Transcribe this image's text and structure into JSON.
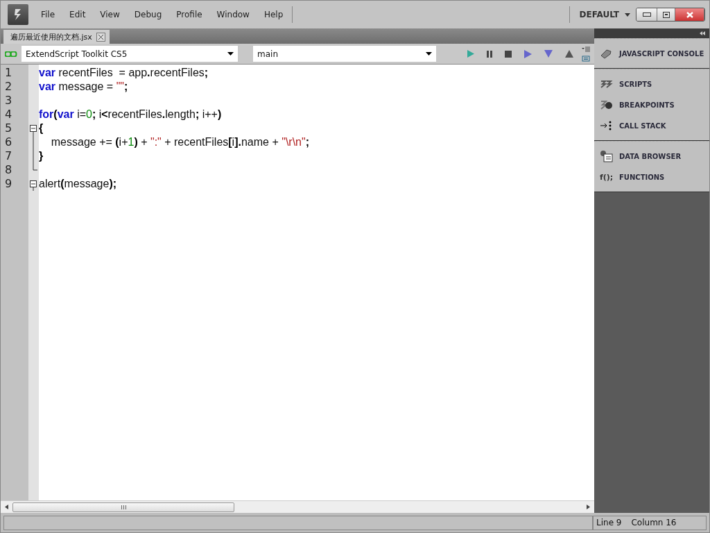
{
  "menu": [
    "File",
    "Edit",
    "View",
    "Debug",
    "Profile",
    "Window",
    "Help"
  ],
  "workspace": "DEFAULT",
  "tabs": [
    {
      "label": "遍历最近使用的文档.jsx",
      "selected": true
    }
  ],
  "toolbar": {
    "target": "ExtendScript Toolkit CS5",
    "engine": "main"
  },
  "code_lines": [
    {
      "number": "1",
      "tokens": [
        {
          "kind": "keyword",
          "t": "var"
        },
        {
          "kind": "plain",
          "t": " recentFiles  = app"
        },
        {
          "kind": "operator",
          "t": "."
        },
        {
          "kind": "plain",
          "t": "recentFiles"
        },
        {
          "kind": "operator",
          "t": ";"
        }
      ]
    },
    {
      "number": "2",
      "tokens": [
        {
          "kind": "keyword",
          "t": "var"
        },
        {
          "kind": "plain",
          "t": " message = "
        },
        {
          "kind": "string",
          "t": "\"\""
        },
        {
          "kind": "operator",
          "t": ";"
        }
      ]
    },
    {
      "number": "3"
    },
    {
      "number": "4",
      "tokens": [
        {
          "kind": "keyword",
          "t": "for"
        },
        {
          "kind": "operator",
          "t": "("
        },
        {
          "kind": "keyword",
          "t": "var"
        },
        {
          "kind": "plain",
          "t": " i="
        },
        {
          "kind": "number",
          "t": "0"
        },
        {
          "kind": "operator",
          "t": ";"
        },
        {
          "kind": "plain",
          "t": " i"
        },
        {
          "kind": "operator",
          "t": "<"
        },
        {
          "kind": "plain",
          "t": "recentFiles"
        },
        {
          "kind": "operator",
          "t": "."
        },
        {
          "kind": "plain",
          "t": "length"
        },
        {
          "kind": "operator",
          "t": ";"
        },
        {
          "kind": "plain",
          "t": " i++"
        },
        {
          "kind": "operator",
          "t": ")"
        }
      ]
    },
    {
      "number": "5",
      "expanded": true,
      "tokens": [
        {
          "kind": "operator",
          "t": "{"
        }
      ],
      "children": [
        {
          "number": "6",
          "tokens": [
            {
              "kind": "plain",
              "t": "    message += "
            },
            {
              "kind": "operator",
              "t": "("
            },
            {
              "kind": "plain",
              "t": "i+"
            },
            {
              "kind": "number",
              "t": "1"
            },
            {
              "kind": "operator",
              "t": ")"
            },
            {
              "kind": "plain",
              "t": " + "
            },
            {
              "kind": "string",
              "t": "\":\""
            },
            {
              "kind": "plain",
              "t": " + recentFiles"
            },
            {
              "kind": "operator",
              "t": "["
            },
            {
              "kind": "plain",
              "t": "i"
            },
            {
              "kind": "operator",
              "t": "]."
            },
            {
              "kind": "plain",
              "t": "name + "
            },
            {
              "kind": "string",
              "t": "\"\\r\\n\""
            },
            {
              "kind": "operator",
              "t": ";"
            }
          ]
        },
        {
          "number": "7",
          "tokens": [
            {
              "kind": "operator",
              "t": "}"
            }
          ]
        },
        {
          "number": "8"
        }
      ]
    },
    {
      "number": "9",
      "expanded": true,
      "tokens": [
        {
          "kind": "plain",
          "t": "alert"
        },
        {
          "kind": "operator",
          "t": "("
        },
        {
          "kind": "plain",
          "t": "message"
        },
        {
          "kind": "operator",
          "t": ");"
        }
      ]
    }
  ],
  "panels": [
    [
      {
        "label": "JAVASCRIPT CONSOLE"
      }
    ],
    [
      {
        "label": "SCRIPTS"
      },
      {
        "label": "BREAKPOINTS"
      },
      {
        "label": "CALL STACK"
      }
    ],
    [
      {
        "label": "DATA BROWSER"
      },
      {
        "label": "FUNCTIONS",
        "glyph": "f();"
      }
    ]
  ],
  "status_bar": {
    "line": "Line 9",
    "column": "Column 16"
  }
}
